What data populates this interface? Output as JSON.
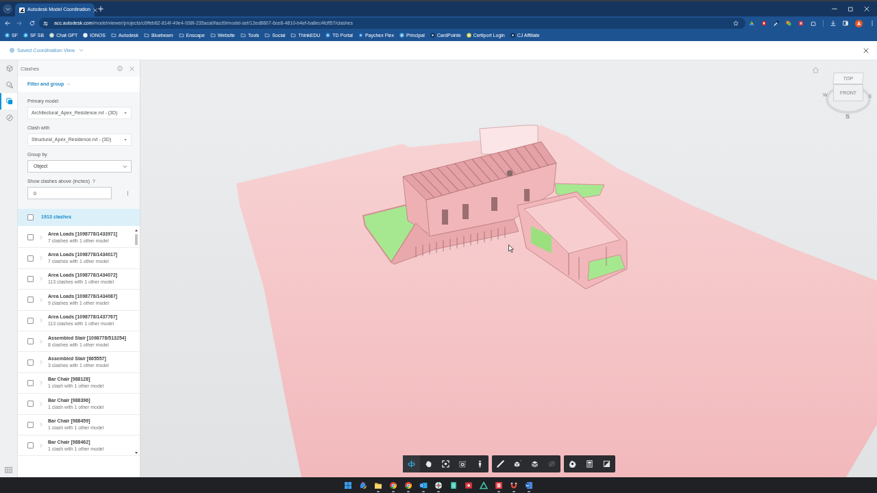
{
  "browser": {
    "tabs": [
      {
        "title": "Autodesk Model Coordination"
      }
    ],
    "url_host": "acc.autodesk.com",
    "url_path": "/model/viewer/projects/c6ffeb82-814f-49e4-938f-235aca0facd9/model-set/12ed8807-6ce8-4810-b4ef-ba8ec4fcff57/clashes",
    "profile_initial": "A",
    "bookmarks": [
      {
        "label": "SF",
        "kind": "site"
      },
      {
        "label": "SF SB",
        "kind": "site"
      },
      {
        "label": "Chat GPT",
        "kind": "site"
      },
      {
        "label": "IONOS",
        "kind": "site"
      },
      {
        "label": "Autodesk",
        "kind": "folder"
      },
      {
        "label": "Bluebeam",
        "kind": "folder"
      },
      {
        "label": "Enscape",
        "kind": "folder"
      },
      {
        "label": "Website",
        "kind": "folder"
      },
      {
        "label": "Tools",
        "kind": "folder"
      },
      {
        "label": "Social",
        "kind": "folder"
      },
      {
        "label": "ThinkEDU",
        "kind": "folder"
      },
      {
        "label": "TD Portal",
        "kind": "site"
      },
      {
        "label": "Paychex Flex",
        "kind": "site"
      },
      {
        "label": "Principal",
        "kind": "site"
      },
      {
        "label": "CardPointe",
        "kind": "site"
      },
      {
        "label": "Certiport Login",
        "kind": "site"
      },
      {
        "label": "CJ Affiliate",
        "kind": "site"
      }
    ]
  },
  "app_header": {
    "view_name": "Saved Coordination View"
  },
  "left_rail": [
    {
      "selected": false
    },
    {
      "selected": false
    },
    {
      "selected": true
    },
    {
      "selected": false
    }
  ],
  "panel": {
    "title": "Clashes",
    "filter": {
      "label": "Filter and group",
      "expanded": true
    },
    "fields": [
      {
        "label": "Primary model",
        "kind": "select",
        "value": "Architectural_Apex_Residence.rvt - (3D)"
      },
      {
        "label": "Clash with",
        "kind": "select",
        "value": "Structural_Apex_Residence.rvt - (3D)"
      },
      {
        "label": "Group by",
        "kind": "dropdown",
        "value": "Object"
      },
      {
        "label": "Show clashes above (inches)",
        "help": "?",
        "kind": "input",
        "value": "0"
      }
    ],
    "summary": {
      "label": "1913 clashes",
      "checked": false,
      "selected": true
    },
    "clashes": [
      {
        "name": "Area Loads [1098778/1433971]",
        "detail": "7 clashes with 1 other model",
        "checked": false,
        "selected": false,
        "expanded": false
      },
      {
        "name": "Area Loads [1098778/1434017]",
        "detail": "7 clashes with 1 other model",
        "checked": false,
        "selected": false,
        "expanded": false
      },
      {
        "name": "Area Loads [1098778/1434072]",
        "detail": "113 clashes with 1 other model",
        "checked": false,
        "selected": false,
        "expanded": false
      },
      {
        "name": "Area Loads [1098778/1434087]",
        "detail": "9 clashes with 1 other model",
        "checked": false,
        "selected": false,
        "expanded": false
      },
      {
        "name": "Area Loads [1098778/1437767]",
        "detail": "113 clashes with 1 other model",
        "checked": false,
        "selected": false,
        "expanded": false
      },
      {
        "name": "Assembled Stair [1098778/513254]",
        "detail": "8 clashes with 1 other model",
        "checked": false,
        "selected": false,
        "expanded": false
      },
      {
        "name": "Assembled Stair [665557]",
        "detail": "3 clashes with 1 other model",
        "checked": false,
        "selected": false,
        "expanded": false
      },
      {
        "name": "Bar Chair [988128]",
        "detail": "1 clash with 1 other model",
        "checked": false,
        "selected": false,
        "expanded": false
      },
      {
        "name": "Bar Chair [988396]",
        "detail": "1 clash with 1 other model",
        "checked": false,
        "selected": false,
        "expanded": false
      },
      {
        "name": "Bar Chair [988459]",
        "detail": "1 clash with 1 other model",
        "checked": false,
        "selected": false,
        "expanded": false
      },
      {
        "name": "Bar Chair [988462]",
        "detail": "1 clash with 1 other model",
        "checked": false,
        "selected": false,
        "expanded": false
      }
    ]
  },
  "viewer": {
    "viewcube": {
      "top": "TOP",
      "front": "FRONT",
      "compass": [
        "W",
        "E",
        "S"
      ]
    },
    "toolbar": [
      {
        "tools": [
          {
            "selected": true,
            "disabled": false
          },
          {
            "selected": false,
            "disabled": false
          },
          {
            "selected": false,
            "disabled": false
          },
          {
            "selected": false,
            "disabled": false
          },
          {
            "selected": false,
            "disabled": false
          }
        ]
      },
      {
        "tools": [
          {
            "selected": false,
            "disabled": false
          },
          {
            "selected": false,
            "disabled": false
          },
          {
            "selected": false,
            "disabled": false
          },
          {
            "selected": false,
            "disabled": true
          }
        ]
      },
      {
        "tools": [
          {
            "selected": false,
            "disabled": false
          },
          {
            "selected": false,
            "disabled": false
          },
          {
            "selected": false,
            "disabled": false
          }
        ]
      }
    ]
  },
  "taskbar": [
    {
      "running": false
    },
    {
      "running": false
    },
    {
      "running": true
    },
    {
      "running": true
    },
    {
      "running": true
    },
    {
      "running": true
    },
    {
      "running": true
    },
    {
      "running": false
    },
    {
      "running": false
    },
    {
      "running": false
    },
    {
      "running": true
    },
    {
      "running": true
    },
    {
      "running": true
    }
  ]
}
